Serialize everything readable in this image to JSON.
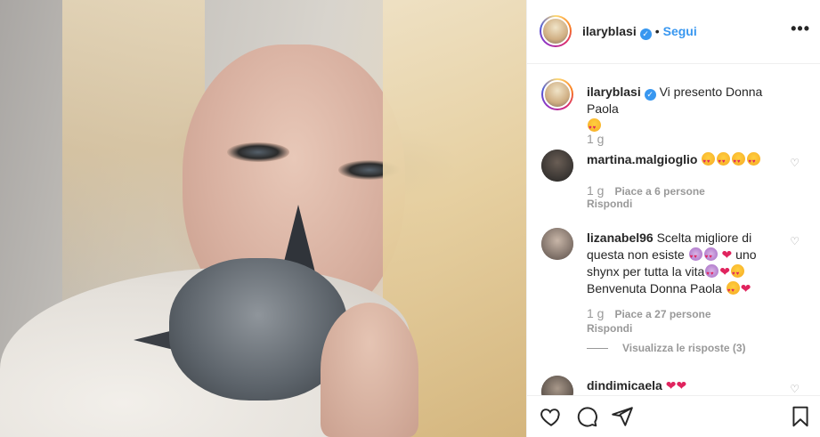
{
  "post": {
    "username": "ilaryblasi",
    "follow_label": "Segui",
    "dot": "•",
    "more_label": "•••",
    "verified_glyph": "✓"
  },
  "caption": {
    "username": "ilaryblasi",
    "text": "Vi presento Donna Paola",
    "time": "1 g"
  },
  "comments": [
    {
      "username": "martina.malgioglio",
      "text": "",
      "emoji_count": 4,
      "time": "1 g",
      "likes": "Piace a 6 persone",
      "reply": "Rispondi"
    },
    {
      "username": "lizanabel96",
      "text": "Scelta migliore di questa non esiste",
      "text2": "uno shynx per tutta la vita",
      "text3": "Benvenuta Donna Paola",
      "time": "1 g",
      "likes": "Piace a 27 persone",
      "reply": "Rispondi",
      "view_replies": "Visualizza le risposte (3)"
    },
    {
      "username": "dindimicaela",
      "text": ""
    }
  ],
  "icons": {
    "like": "heart-icon",
    "comment": "comment-icon",
    "share": "share-icon",
    "save": "bookmark-icon"
  },
  "colors": {
    "link": "#3897f0",
    "heart": "#e0245e",
    "muted": "#999999"
  }
}
